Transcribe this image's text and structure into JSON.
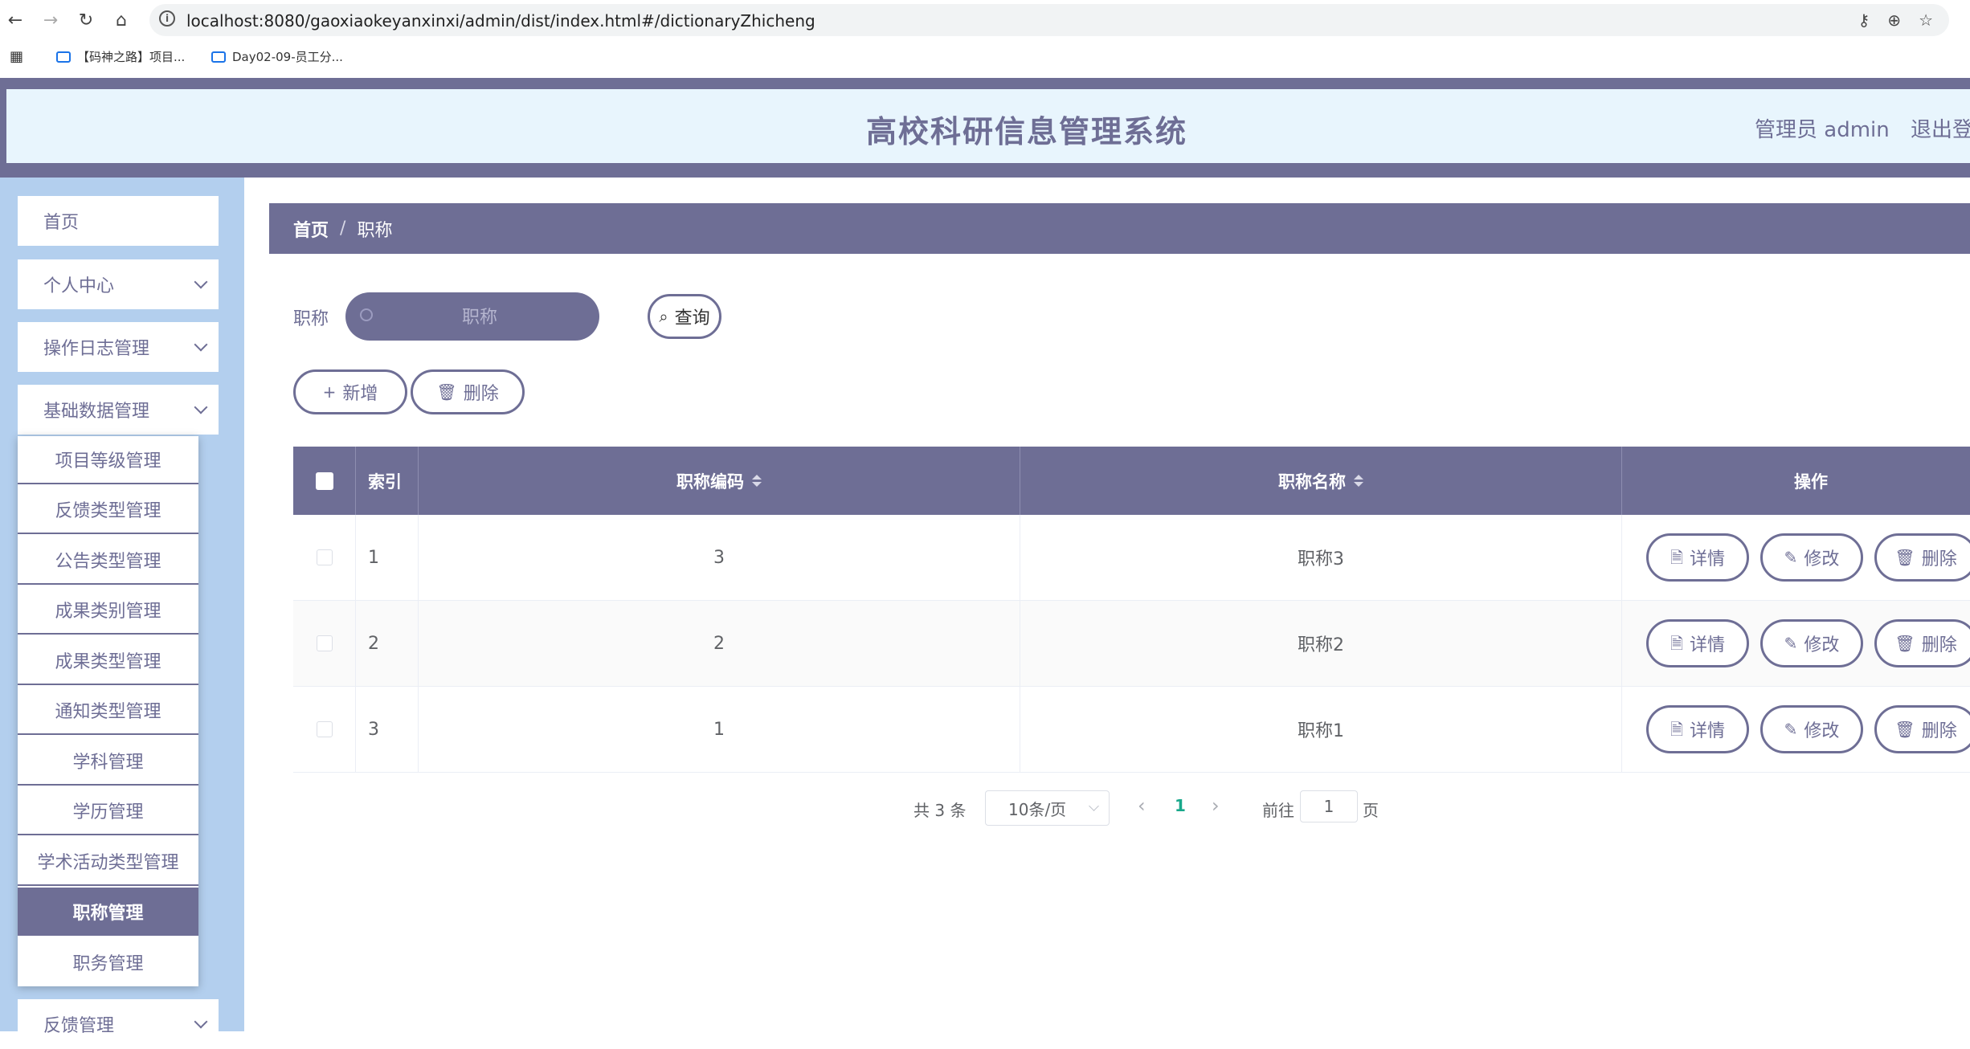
{
  "browser": {
    "url": "localhost:8080/gaoxiaokeyanxinxi/admin/dist/index.html#/dictionaryZhicheng",
    "bookmarks": [
      "【码神之路】项目...",
      "Day02-09-员工分..."
    ]
  },
  "header": {
    "title": "高校科研信息管理系统",
    "user": "管理员 admin",
    "logout": "退出登"
  },
  "sidebar": {
    "items": [
      {
        "label": "首页"
      },
      {
        "label": "个人中心"
      },
      {
        "label": "操作日志管理"
      },
      {
        "label": "基础数据管理"
      },
      {
        "label": "反馈管理"
      }
    ],
    "submenu": [
      "项目等级管理",
      "反馈类型管理",
      "公告类型管理",
      "成果类别管理",
      "成果类型管理",
      "通知类型管理",
      "学科管理",
      "学历管理",
      "学术活动类型管理",
      "职称管理",
      "职务管理"
    ],
    "active_submenu": "职称管理"
  },
  "breadcrumb": {
    "home": "首页",
    "separator": "/",
    "current": "职称"
  },
  "search": {
    "label": "职称",
    "placeholder": "职称",
    "button": "查询"
  },
  "actions": {
    "add": "新增",
    "delete": "删除"
  },
  "table": {
    "headers": {
      "index": "索引",
      "code": "职称编码",
      "name": "职称名称",
      "ops": "操作"
    },
    "rows": [
      {
        "index": "1",
        "code": "3",
        "name": "职称3"
      },
      {
        "index": "2",
        "code": "2",
        "name": "职称2"
      },
      {
        "index": "3",
        "code": "1",
        "name": "职称1"
      }
    ],
    "row_actions": {
      "detail": "详情",
      "edit": "修改",
      "delete": "删除"
    }
  },
  "pagination": {
    "total": "共 3 条",
    "page_size": "10条/页",
    "current_page": "1",
    "goto_label": "前往",
    "goto_value": "1",
    "page_suffix": "页"
  },
  "colors": {
    "primary": "#6e6e95",
    "header_bg": "#e8f5fd",
    "sidebar_bg": "#b3cfee",
    "page_active": "#19a88b"
  }
}
